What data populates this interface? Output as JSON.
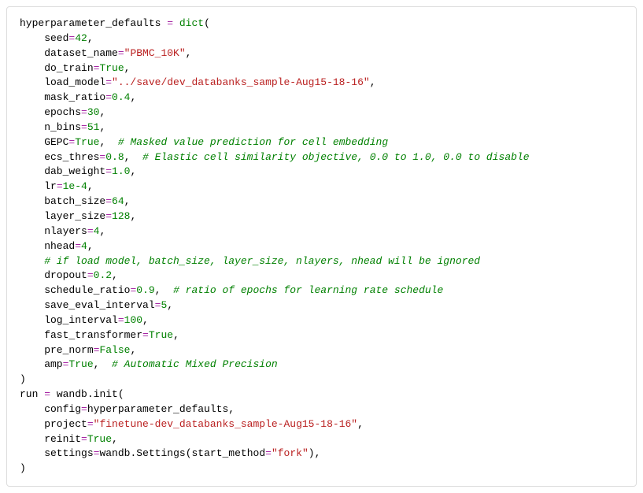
{
  "code": {
    "l01_hpd": "hyperparameter_defaults",
    "l01_eq": " = ",
    "l01_dict": "dict",
    "l01_open": "(",
    "l02_k": "    seed",
    "l02_eq": "=",
    "l02_v": "42",
    "l02_c": ",",
    "l03_k": "    dataset_name",
    "l03_eq": "=",
    "l03_v": "\"PBMC_10K\"",
    "l03_c": ",",
    "l04_k": "    do_train",
    "l04_eq": "=",
    "l04_v": "True",
    "l04_c": ",",
    "l05_k": "    load_model",
    "l05_eq": "=",
    "l05_v": "\"../save/dev_databanks_sample-Aug15-18-16\"",
    "l05_c": ",",
    "l06_k": "    mask_ratio",
    "l06_eq": "=",
    "l06_v": "0.4",
    "l06_c": ",",
    "l07_k": "    epochs",
    "l07_eq": "=",
    "l07_v": "30",
    "l07_c": ",",
    "l08_k": "    n_bins",
    "l08_eq": "=",
    "l08_v": "51",
    "l08_c": ",",
    "l09_k": "    GEPC",
    "l09_eq": "=",
    "l09_v": "True",
    "l09_c": ",  ",
    "l09_cm": "# Masked value prediction for cell embedding",
    "l10_k": "    ecs_thres",
    "l10_eq": "=",
    "l10_v": "0.8",
    "l10_c": ",  ",
    "l10_cm": "# Elastic cell similarity objective, 0.0 to 1.0, 0.0 to disable",
    "l11_k": "    dab_weight",
    "l11_eq": "=",
    "l11_v": "1.0",
    "l11_c": ",",
    "l12_k": "    lr",
    "l12_eq": "=",
    "l12_v": "1e-4",
    "l12_c": ",",
    "l13_k": "    batch_size",
    "l13_eq": "=",
    "l13_v": "64",
    "l13_c": ",",
    "l14_k": "    layer_size",
    "l14_eq": "=",
    "l14_v": "128",
    "l14_c": ",",
    "l15_k": "    nlayers",
    "l15_eq": "=",
    "l15_v": "4",
    "l15_c": ",",
    "l16_k": "    nhead",
    "l16_eq": "=",
    "l16_v": "4",
    "l16_c": ",",
    "l17_cm": "    # if load model, batch_size, layer_size, nlayers, nhead will be ignored",
    "l18_k": "    dropout",
    "l18_eq": "=",
    "l18_v": "0.2",
    "l18_c": ",",
    "l19_k": "    schedule_ratio",
    "l19_eq": "=",
    "l19_v": "0.9",
    "l19_c": ",  ",
    "l19_cm": "# ratio of epochs for learning rate schedule",
    "l20_k": "    save_eval_interval",
    "l20_eq": "=",
    "l20_v": "5",
    "l20_c": ",",
    "l21_k": "    log_interval",
    "l21_eq": "=",
    "l21_v": "100",
    "l21_c": ",",
    "l22_k": "    fast_transformer",
    "l22_eq": "=",
    "l22_v": "True",
    "l22_c": ",",
    "l23_k": "    pre_norm",
    "l23_eq": "=",
    "l23_v": "False",
    "l23_c": ",",
    "l24_k": "    amp",
    "l24_eq": "=",
    "l24_v": "True",
    "l24_c": ",  ",
    "l24_cm": "# Automatic Mixed Precision",
    "l25_close": ")",
    "l26_run": "run",
    "l26_eq": " = ",
    "l26_wandb": "wandb",
    "l26_dot": ".",
    "l26_init": "init",
    "l26_open": "(",
    "l27_k": "    config",
    "l27_eq": "=",
    "l27_v": "hyperparameter_defaults",
    "l27_c": ",",
    "l28_k": "    project",
    "l28_eq": "=",
    "l28_v": "\"finetune-dev_databanks_sample-Aug15-18-16\"",
    "l28_c": ",",
    "l29_k": "    reinit",
    "l29_eq": "=",
    "l29_v": "True",
    "l29_c": ",",
    "l30_k": "    settings",
    "l30_eq": "=",
    "l30_wandb": "wandb",
    "l30_dot": ".",
    "l30_set": "Settings",
    "l30_open": "(",
    "l30_sk": "start_method",
    "l30_seq": "=",
    "l30_sv": "\"fork\"",
    "l30_close": ")",
    "l30_c": ",",
    "l31_close": ")"
  }
}
